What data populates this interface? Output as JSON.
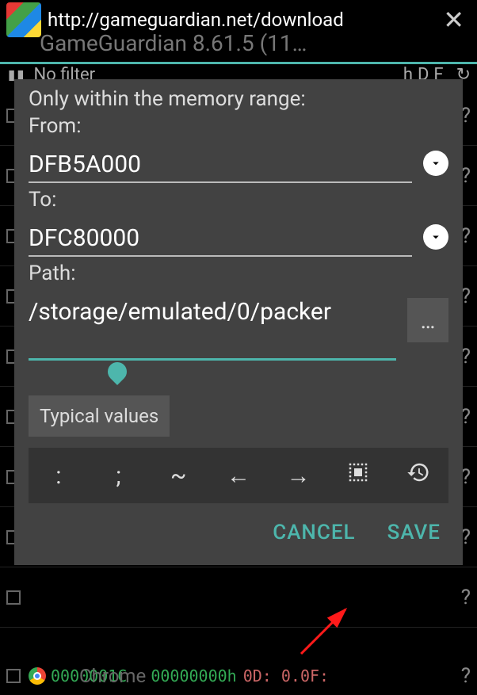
{
  "url": "http://gameguardian.net/download",
  "app_title": "GameGuardian 8.61.5 (11…",
  "filter": {
    "text": "No filter",
    "flags": "hDF"
  },
  "dialog": {
    "title": "Only within the memory range:",
    "from_label": "From:",
    "from_value": "DFB5A000",
    "to_label": "To:",
    "to_value": "DFC80000",
    "path_label": "Path:",
    "path_value": "/storage/emulated/0/packer",
    "typical_label": "Typical values",
    "cancel_label": "CANCEL",
    "save_label": "SAVE"
  },
  "toolbar_symbols": {
    "colon": ":",
    "semicolon": ";",
    "tilde": "~",
    "left": "←",
    "right": "→"
  },
  "bottom": {
    "addr1": "0000001C",
    "addr2": "00000000h",
    "val": "0D: 0.0F:",
    "chrome": "Chrome"
  }
}
